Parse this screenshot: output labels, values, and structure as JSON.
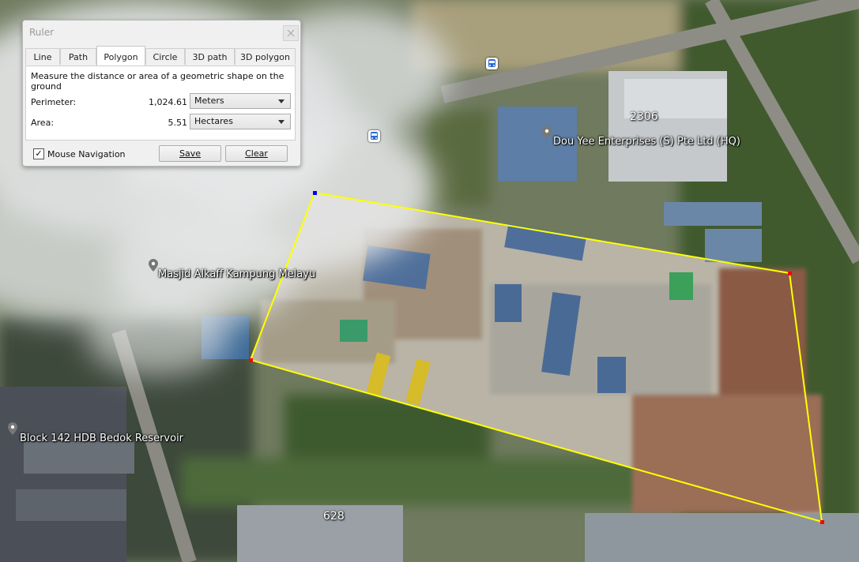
{
  "map": {
    "labels": [
      {
        "id": "masjid",
        "text": "Masjid Alkaff Kampung Melayu"
      },
      {
        "id": "block142",
        "text": "Block 142 HDB Bedok Reservoir"
      },
      {
        "id": "douyee",
        "text": "Dou Yee Enterprises (S) Pte Ltd (HQ)"
      }
    ],
    "numbers": {
      "building_2306": "2306",
      "building_628": "628"
    },
    "colors": {
      "polygon_line": "#ffff00",
      "vertex_red": "#ff0000",
      "vertex_blue": "#0000ff"
    }
  },
  "ruler": {
    "title": "Ruler",
    "tabs": [
      "Line",
      "Path",
      "Polygon",
      "Circle",
      "3D path",
      "3D polygon"
    ],
    "active_tab": "Polygon",
    "description": "Measure the distance or area of a geometric shape on the ground",
    "perimeter": {
      "label": "Perimeter:",
      "value": "1,024.61",
      "unit": "Meters"
    },
    "area": {
      "label": "Area:",
      "value": "5.51",
      "unit": "Hectares"
    },
    "mouse_navigation": {
      "label": "Mouse Navigation",
      "checked": true,
      "check_glyph": "✓"
    },
    "save_label": "Save",
    "clear_label": "Clear"
  }
}
